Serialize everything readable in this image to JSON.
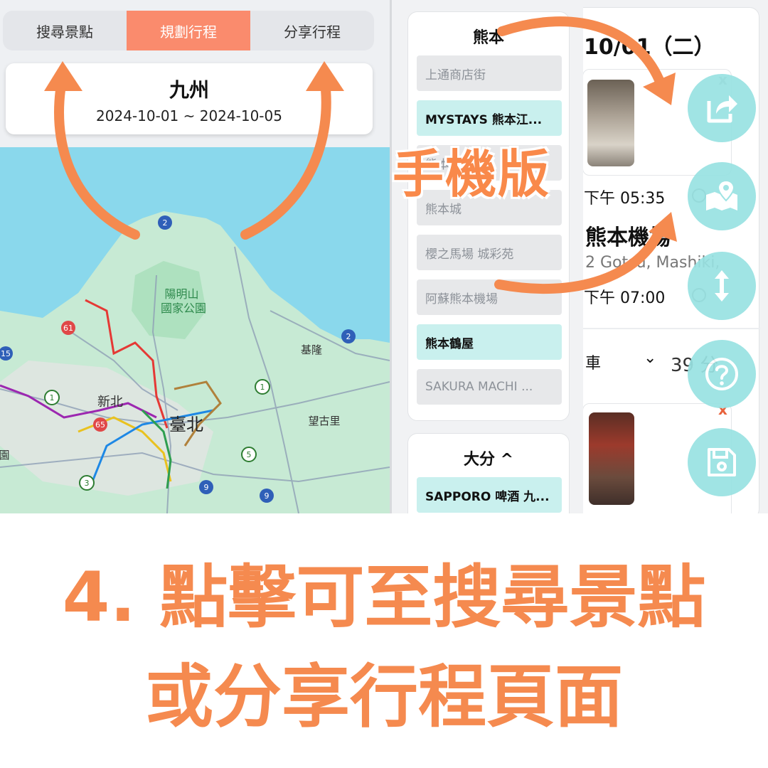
{
  "tabs": [
    {
      "label": "搜尋景點",
      "active": false
    },
    {
      "label": "規劃行程",
      "active": true
    },
    {
      "label": "分享行程",
      "active": false
    }
  ],
  "trip": {
    "title": "九州",
    "dates": "2024-10-01 ~ 2024-10-05"
  },
  "map": {
    "labels": {
      "park": "陽明山\n國家公園",
      "newtaipei": "新北",
      "taipei": "臺北",
      "keelung": "基隆",
      "wangguli": "望古里",
      "yuan": "園"
    },
    "route_numbers": [
      "2",
      "61",
      "15",
      "1",
      "65",
      "2",
      "1",
      "5",
      "3",
      "9",
      "9"
    ]
  },
  "regions": [
    {
      "name": "熊本",
      "places": [
        {
          "name": "上通商店街",
          "style": "gray"
        },
        {
          "name": "MYSTAYS 熊本江...",
          "style": "cyan"
        },
        {
          "name": "熊本",
          "style": "gray"
        },
        {
          "name": "熊本城",
          "style": "gray"
        },
        {
          "name": "櫻之馬場 城彩苑",
          "style": "gray"
        },
        {
          "name": "阿蘇熊本機場",
          "style": "gray"
        },
        {
          "name": "熊本鶴屋",
          "style": "cyan"
        },
        {
          "name": "SAKURA MACHI ...",
          "style": "gray"
        }
      ]
    },
    {
      "name": "大分 ^",
      "places": [
        {
          "name": "SAPPORO 啤酒 九...",
          "style": "cyan"
        }
      ]
    }
  ],
  "itinerary": {
    "day_title": "10/01（二）",
    "times": [
      "下午 05:35",
      "下午 07:00"
    ],
    "place_partial": "熊本機場",
    "address_partial": "2 Gotsu, Mashiki,",
    "transport": {
      "mode": "車",
      "duration": "39 分"
    },
    "delete_label": "x"
  },
  "fabs": [
    "share-icon",
    "map-icon",
    "reorder-icon",
    "help-icon",
    "save-icon"
  ],
  "annotation": {
    "mobile_label": "手機版",
    "caption_line1": "4. 點擊可至搜尋景點",
    "caption_line2": "或分享行程頁面"
  },
  "colors": {
    "accent": "#fa8b6d",
    "annotation": "#f58a4f",
    "fab": "#98e2e2",
    "place_cyan": "#c9f0ee",
    "place_gray": "#e7e8ea",
    "delete_red": "#e8623c"
  }
}
